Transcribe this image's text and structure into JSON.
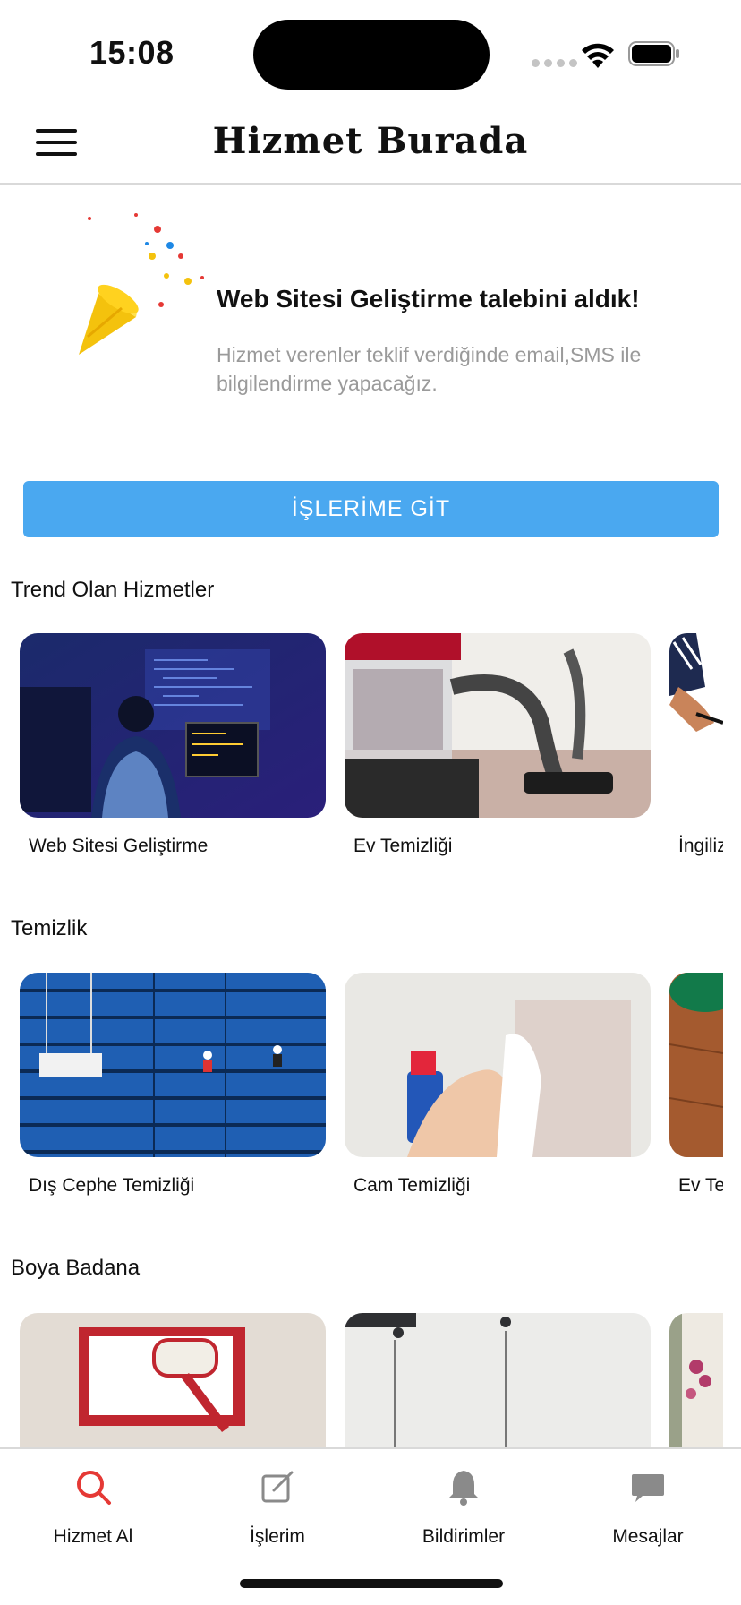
{
  "status_bar": {
    "time": "15:08"
  },
  "header": {
    "title": "Hizmet Burada",
    "menu_icon": "hamburger-menu-icon"
  },
  "success": {
    "icon": "party-popper-icon",
    "title": "Web Sitesi Geliştirme talebini aldık!",
    "description": "Hizmet verenler teklif verdiğinde email,SMS ile bilgilendirme yapacağız."
  },
  "primary_button": {
    "label": "İŞLERİME GİT",
    "color": "#4aa8f0"
  },
  "sections": [
    {
      "title": "Trend Olan Hizmetler",
      "cards": [
        {
          "label": "Web Sitesi Geliştirme"
        },
        {
          "label": "Ev Temizliği"
        },
        {
          "label": "İngiliz"
        }
      ]
    },
    {
      "title": "Temizlik",
      "cards": [
        {
          "label": "Dış Cephe Temizliği"
        },
        {
          "label": "Cam Temizliği"
        },
        {
          "label": "Ev Te"
        }
      ]
    },
    {
      "title": "Boya Badana",
      "cards": [
        {
          "label": ""
        },
        {
          "label": ""
        },
        {
          "label": ""
        }
      ]
    }
  ],
  "bottom_nav": {
    "active_color": "#e53935",
    "items": [
      {
        "label": "Hizmet Al",
        "icon": "search-icon",
        "active": true
      },
      {
        "label": "İşlerim",
        "icon": "edit-icon",
        "active": false
      },
      {
        "label": "Bildirimler",
        "icon": "bell-icon",
        "active": false
      },
      {
        "label": "Mesajlar",
        "icon": "chat-bubble-icon",
        "active": false
      }
    ]
  }
}
